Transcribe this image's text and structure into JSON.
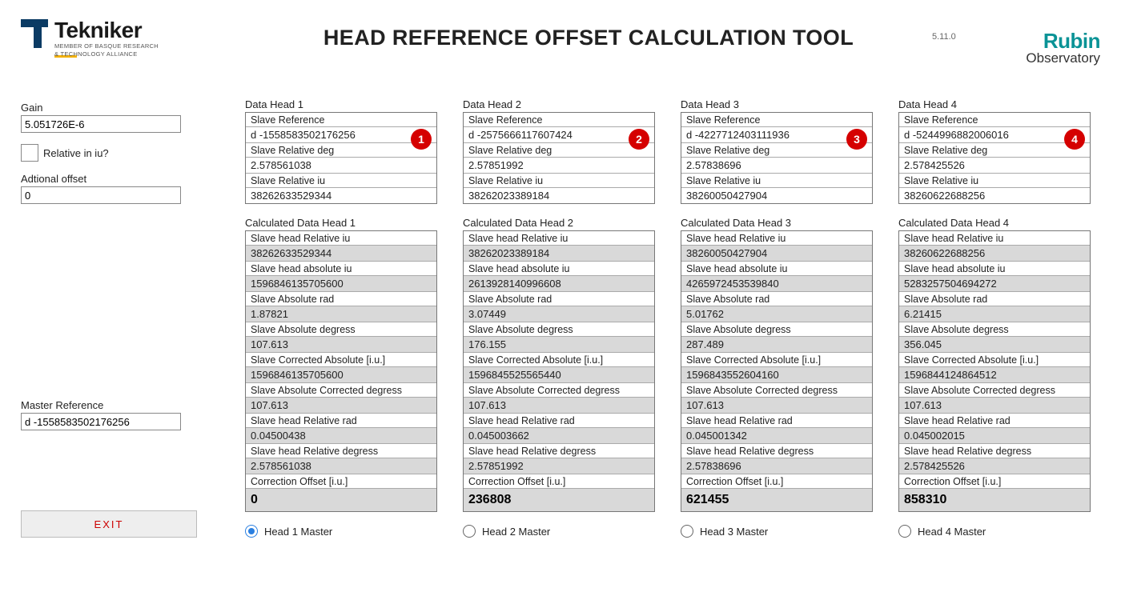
{
  "app": {
    "title": "HEAD REFERENCE OFFSET CALCULATION TOOL",
    "version": "5.11.0"
  },
  "logos": {
    "tekniker": {
      "name": "Tekniker",
      "sub1": "MEMBER OF BASQUE RESEARCH",
      "sub2": "& TECHNOLOGY ALLIANCE"
    },
    "rubin": {
      "name": "Rubin",
      "sub": "Observatory"
    }
  },
  "left": {
    "gain_label": "Gain",
    "gain_value": "5.051726E-6",
    "relative_iu_label": "Relative in iu?",
    "relative_iu_checked": false,
    "additional_offset_label": "Adtional offset",
    "additional_offset_value": "0",
    "master_ref_label": "Master Reference",
    "master_ref_value": "d -1558583502176256",
    "exit_label": "EXIT"
  },
  "field_labels": {
    "slave_reference": "Slave Reference",
    "slave_relative_deg": "Slave Relative deg",
    "slave_relative_iu": "Slave Relative iu",
    "slave_head_relative_iu": "Slave head Relative iu",
    "slave_head_absolute_iu": "Slave head absolute iu",
    "slave_absolute_rad": "Slave Absolute rad",
    "slave_absolute_deg": "Slave Absolute degress",
    "slave_corrected_abs_iu": "Slave Corrected Absolute [i.u.]",
    "slave_abs_corrected_deg": "Slave Absolute Corrected degress",
    "slave_head_relative_rad": "Slave head Relative rad",
    "slave_head_relative_deg": "Slave head Relative degress",
    "correction_offset": "Correction Offset [i.u.]"
  },
  "heads": [
    {
      "idx": "1",
      "data_title": "Data Head 1",
      "calc_title": "Calculated Data Head 1",
      "slave_reference": "d -1558583502176256",
      "slave_relative_deg": "2.578561038",
      "slave_relative_iu": "38262633529344",
      "c_slave_head_relative_iu": "38262633529344",
      "c_slave_head_absolute_iu": "1596846135705600",
      "c_slave_absolute_rad": "1.87821",
      "c_slave_absolute_deg": "107.613",
      "c_slave_corrected_abs_iu": "1596846135705600",
      "c_slave_abs_corrected_deg": "107.613",
      "c_slave_head_relative_rad": "0.04500438",
      "c_slave_head_relative_deg": "2.578561038",
      "correction_offset": "0",
      "radio_label": "Head 1 Master",
      "radio_selected": true
    },
    {
      "idx": "2",
      "data_title": "Data Head 2",
      "calc_title": "Calculated Data Head 2",
      "slave_reference": "d -2575666117607424",
      "slave_relative_deg": "2.57851992",
      "slave_relative_iu": "38262023389184",
      "c_slave_head_relative_iu": "38262023389184",
      "c_slave_head_absolute_iu": "2613928140996608",
      "c_slave_absolute_rad": "3.07449",
      "c_slave_absolute_deg": "176.155",
      "c_slave_corrected_abs_iu": "1596845525565440",
      "c_slave_abs_corrected_deg": "107.613",
      "c_slave_head_relative_rad": "0.045003662",
      "c_slave_head_relative_deg": "2.57851992",
      "correction_offset": "236808",
      "radio_label": "Head 2 Master",
      "radio_selected": false
    },
    {
      "idx": "3",
      "data_title": "Data Head 3",
      "calc_title": "Calculated Data Head 3",
      "slave_reference": "d -4227712403111936",
      "slave_relative_deg": "2.57838696",
      "slave_relative_iu": "38260050427904",
      "c_slave_head_relative_iu": "38260050427904",
      "c_slave_head_absolute_iu": "4265972453539840",
      "c_slave_absolute_rad": "5.01762",
      "c_slave_absolute_deg": "287.489",
      "c_slave_corrected_abs_iu": "1596843552604160",
      "c_slave_abs_corrected_deg": "107.613",
      "c_slave_head_relative_rad": "0.045001342",
      "c_slave_head_relative_deg": "2.57838696",
      "correction_offset": "621455",
      "radio_label": "Head 3 Master",
      "radio_selected": false
    },
    {
      "idx": "4",
      "data_title": "Data Head 4",
      "calc_title": "Calculated Data Head 4",
      "slave_reference": "d -5244996882006016",
      "slave_relative_deg": "2.578425526",
      "slave_relative_iu": "38260622688256",
      "c_slave_head_relative_iu": "38260622688256",
      "c_slave_head_absolute_iu": "5283257504694272",
      "c_slave_absolute_rad": "6.21415",
      "c_slave_absolute_deg": "356.045",
      "c_slave_corrected_abs_iu": "1596844124864512",
      "c_slave_abs_corrected_deg": "107.613",
      "c_slave_head_relative_rad": "0.045002015",
      "c_slave_head_relative_deg": "2.578425526",
      "correction_offset": "858310",
      "radio_label": "Head 4 Master",
      "radio_selected": false
    }
  ]
}
